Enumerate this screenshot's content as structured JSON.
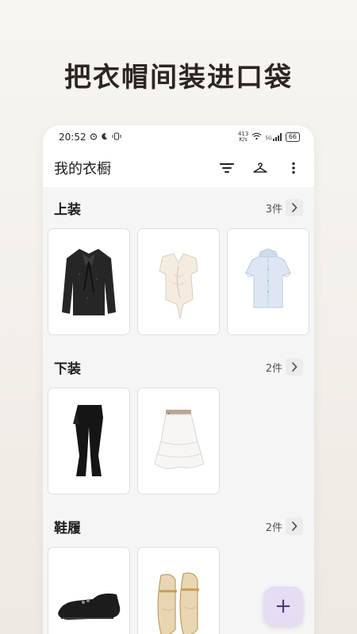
{
  "headline": "把衣帽间装进口袋",
  "status_bar": {
    "time": "20:52",
    "alarm_icon": "alarm-icon",
    "moon_icon": "moon-icon",
    "vibrate_icon": "vibrate-icon",
    "net_speed_value": "413",
    "net_speed_unit": "K/s",
    "wifi_icon": "wifi-icon",
    "signal_label": "5G",
    "battery": "66"
  },
  "app_bar": {
    "title": "我的衣橱",
    "filter_icon": "filter-icon",
    "hanger_icon": "hanger-icon",
    "more_icon": "more-vertical-icon"
  },
  "sections": [
    {
      "title": "上装",
      "count": "3件",
      "items": [
        "black-bow-blouse",
        "cream-ruched-top",
        "light-blue-ruffle-blouse"
      ]
    },
    {
      "title": "下装",
      "count": "2件",
      "items": [
        "black-flare-pants",
        "white-tiered-skirt"
      ]
    },
    {
      "title": "鞋履",
      "count": "2件",
      "items": [
        "black-leather-loafers",
        "gold-mary-jane-flats"
      ]
    }
  ],
  "fab": {
    "label": "+"
  },
  "colors": {
    "background": "#f4f0eb",
    "phone_bg": "#f5f5f6",
    "fab_bg": "#e6dcf4",
    "fab_icon": "#4a3d73"
  }
}
